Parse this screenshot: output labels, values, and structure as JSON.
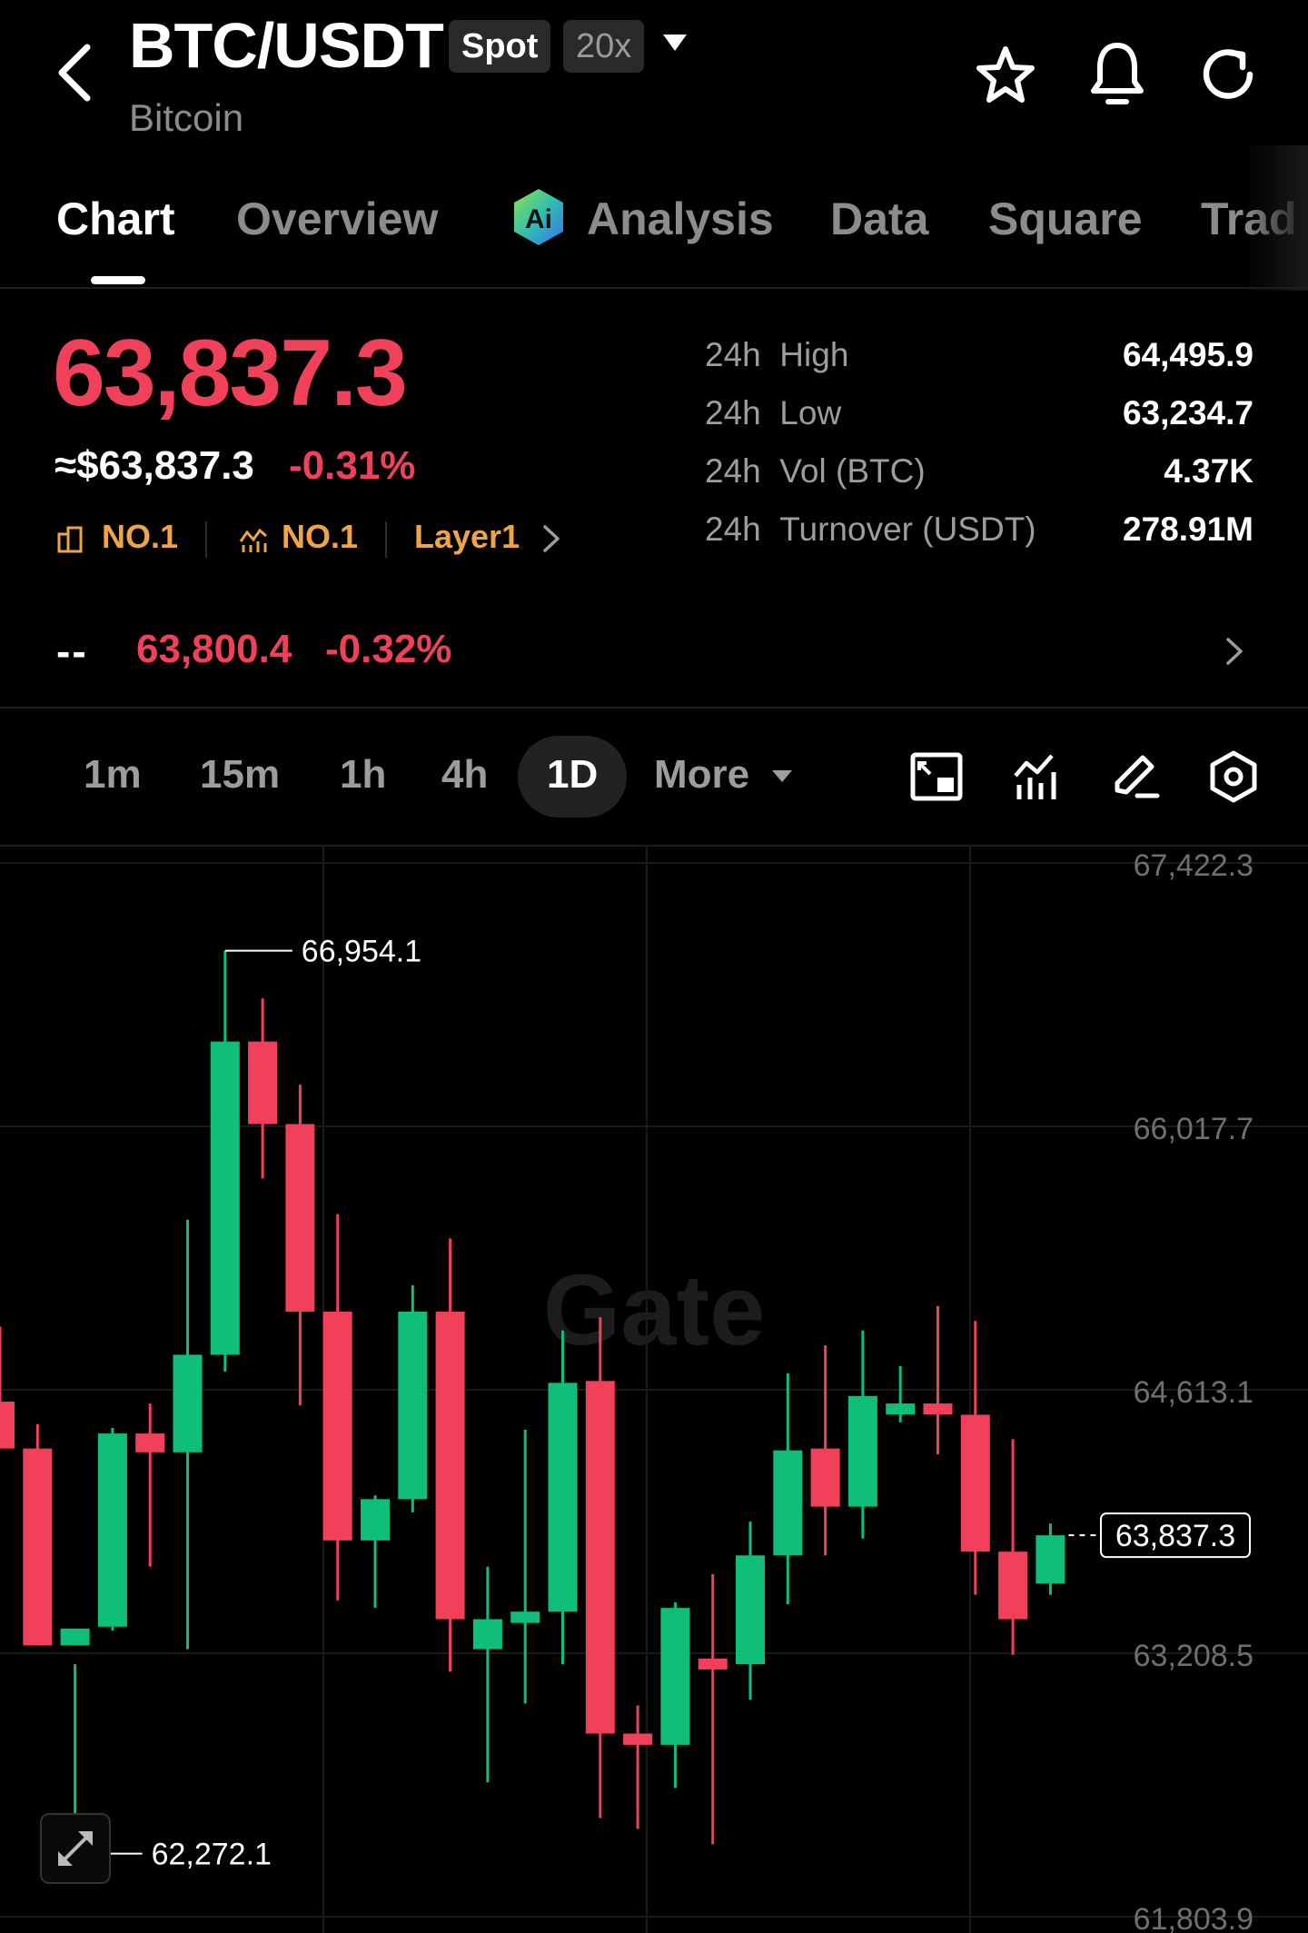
{
  "header": {
    "pair": "BTC/USDT",
    "market_tag": "Spot",
    "leverage_tag": "20x",
    "subtitle": "Bitcoin"
  },
  "tabs": [
    {
      "label": "Chart",
      "active": true
    },
    {
      "label": "Overview"
    },
    {
      "label": "Analysis"
    },
    {
      "label": "Data"
    },
    {
      "label": "Square"
    },
    {
      "label": "Trad"
    }
  ],
  "price": {
    "last": "63,837.3",
    "usd": "≈$63,837.3",
    "change": "-0.31%",
    "rank_market_cap": "NO.1",
    "rank_trend": "NO.1",
    "category": "Layer1"
  },
  "stats": [
    {
      "period": "24h",
      "label": "High",
      "value": "64,495.9"
    },
    {
      "period": "24h",
      "label": "Low",
      "value": "63,234.7"
    },
    {
      "period": "24h",
      "label": "Vol (BTC)",
      "value": "4.37K"
    },
    {
      "period": "24h",
      "label": "Turnover (USDT)",
      "value": "278.91M"
    }
  ],
  "secondary": {
    "mark": "--",
    "price": "63,800.4",
    "change": "-0.32%"
  },
  "toolbar": {
    "timeframes": [
      "1m",
      "15m",
      "1h",
      "4h",
      "1D"
    ],
    "active": "1D",
    "more_label": "More"
  },
  "colors": {
    "up": "#0fbf79",
    "down": "#f0405a",
    "accent_orange": "#f0a44a"
  },
  "watermark": "Gate",
  "chart_data": {
    "type": "candlestick",
    "y_ticks": [
      "67,422.3",
      "66,017.7",
      "64,613.1",
      "63,208.5",
      "61,803.9"
    ],
    "ylim": [
      61803.9,
      67422.3
    ],
    "high_label": "66,954.1",
    "low_label": "62,272.1",
    "current_label": "63,837.3",
    "current": 63837.3,
    "candles": [
      {
        "o": 64550,
        "h": 64950,
        "l": 64300,
        "c": 64300
      },
      {
        "o": 64300,
        "h": 64430,
        "l": 63250,
        "c": 63250
      },
      {
        "o": 63250,
        "h": 63150,
        "l": 62140,
        "c": 63340
      },
      {
        "o": 63350,
        "h": 64410,
        "l": 63330,
        "c": 64380
      },
      {
        "o": 64380,
        "h": 64540,
        "l": 63670,
        "c": 64280
      },
      {
        "o": 64280,
        "h": 65520,
        "l": 63230,
        "c": 64800
      },
      {
        "o": 64800,
        "h": 66954.1,
        "l": 64710,
        "c": 66470
      },
      {
        "o": 66470,
        "h": 66700,
        "l": 65740,
        "c": 66030
      },
      {
        "o": 66030,
        "h": 66240,
        "l": 64530,
        "c": 65030
      },
      {
        "o": 65030,
        "h": 65550,
        "l": 63490,
        "c": 63810
      },
      {
        "o": 63810,
        "h": 64050,
        "l": 63450,
        "c": 64030
      },
      {
        "o": 64030,
        "h": 65170,
        "l": 63960,
        "c": 65030
      },
      {
        "o": 65030,
        "h": 65420,
        "l": 63110,
        "c": 63390
      },
      {
        "o": 63230,
        "h": 63670,
        "l": 62520,
        "c": 63390
      },
      {
        "o": 63370,
        "h": 64400,
        "l": 62940,
        "c": 63430
      },
      {
        "o": 63430,
        "h": 64930,
        "l": 63150,
        "c": 64650
      },
      {
        "o": 64660,
        "h": 65000,
        "l": 62330,
        "c": 62780
      },
      {
        "o": 62780,
        "h": 62930,
        "l": 62272.1,
        "c": 62720
      },
      {
        "o": 62720,
        "h": 63480,
        "l": 62490,
        "c": 63450
      },
      {
        "o": 63180,
        "h": 63630,
        "l": 62190,
        "c": 63150
      },
      {
        "o": 63150,
        "h": 63910,
        "l": 62960,
        "c": 63730
      },
      {
        "o": 63730,
        "h": 64700,
        "l": 63470,
        "c": 64290
      },
      {
        "o": 64300,
        "h": 64850,
        "l": 63730,
        "c": 63990
      },
      {
        "o": 63990,
        "h": 64930,
        "l": 63820,
        "c": 64580
      },
      {
        "o": 64500,
        "h": 64740,
        "l": 64440,
        "c": 64540
      },
      {
        "o": 64540,
        "h": 65060,
        "l": 64270,
        "c": 64490
      },
      {
        "o": 64480,
        "h": 64980,
        "l": 63520,
        "c": 63750
      },
      {
        "o": 63750,
        "h": 64350,
        "l": 63200,
        "c": 63390
      },
      {
        "o": 63580,
        "h": 63900,
        "l": 63520,
        "c": 63837.3
      }
    ]
  }
}
